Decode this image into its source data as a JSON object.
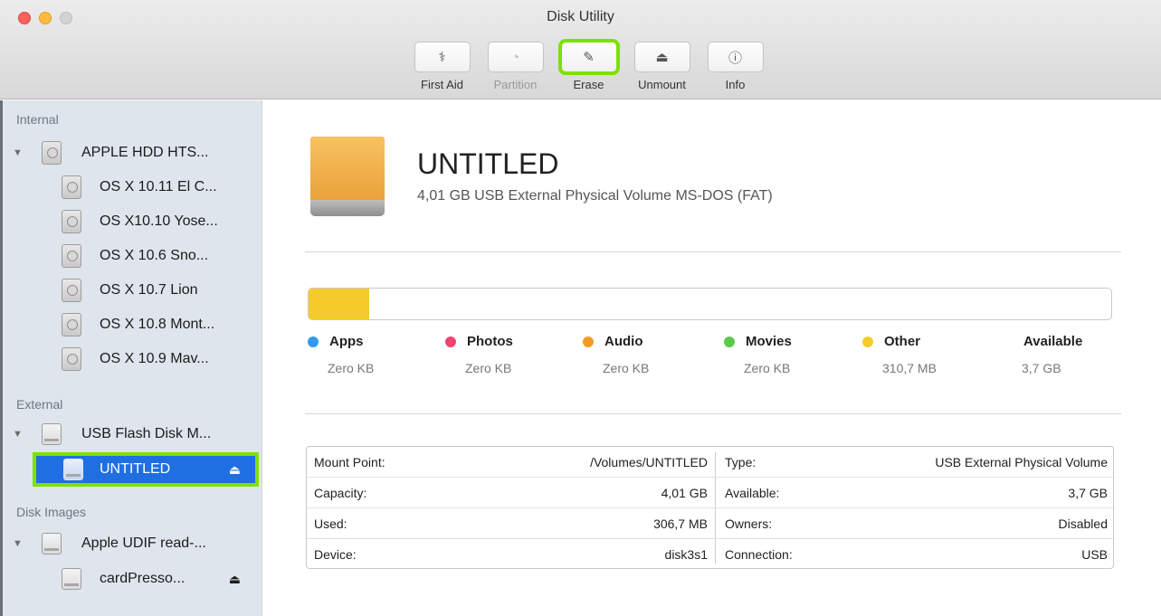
{
  "window": {
    "title": "Disk Utility"
  },
  "toolbar": {
    "buttons": [
      {
        "label": "First Aid",
        "icon": "stethoscope-icon",
        "glyph": "⚕",
        "enabled": true,
        "highlighted": false
      },
      {
        "label": "Partition",
        "icon": "partition-icon",
        "glyph": "◔",
        "enabled": false,
        "highlighted": false
      },
      {
        "label": "Erase",
        "icon": "erase-icon",
        "glyph": "✎",
        "enabled": true,
        "highlighted": true
      },
      {
        "label": "Unmount",
        "icon": "unmount-icon",
        "glyph": "⏏",
        "enabled": true,
        "highlighted": false
      },
      {
        "label": "Info",
        "icon": "info-icon",
        "glyph": "ⓘ",
        "enabled": true,
        "highlighted": false
      }
    ]
  },
  "sidebar": {
    "sections": {
      "internal": "Internal",
      "external": "External",
      "disk_images": "Disk Images"
    },
    "items": [
      {
        "label": "APPLE HDD HTS...",
        "level": 0,
        "kind": "disk"
      },
      {
        "label": "OS X 10.11 El C...",
        "level": 1,
        "kind": "disk"
      },
      {
        "label": "OS X10.10 Yose...",
        "level": 1,
        "kind": "disk"
      },
      {
        "label": "OS X 10.6 Sno...",
        "level": 1,
        "kind": "disk"
      },
      {
        "label": "OS X 10.7 Lion",
        "level": 1,
        "kind": "disk"
      },
      {
        "label": "OS X 10.8 Mont...",
        "level": 1,
        "kind": "disk"
      },
      {
        "label": "OS X 10.9 Mav...",
        "level": 1,
        "kind": "disk"
      },
      {
        "label": "USB Flash Disk M...",
        "level": 0,
        "kind": "usb"
      },
      {
        "label": "UNTITLED",
        "level": 1,
        "kind": "usb",
        "selected": true,
        "eject": "⏏"
      },
      {
        "label": "Apple UDIF read-...",
        "level": 0,
        "kind": "usb"
      },
      {
        "label": "cardPresso...",
        "level": 1,
        "kind": "usb",
        "eject": "⏏"
      }
    ]
  },
  "volume": {
    "name": "UNTITLED",
    "description": "4,01 GB USB External Physical Volume MS-DOS (FAT)",
    "icon": "external-drive-icon"
  },
  "usage": {
    "segments": [
      {
        "name": "Other",
        "fraction": 0.076,
        "color": "#f5cb2c"
      }
    ]
  },
  "legend": [
    {
      "name": "Apps",
      "value": "Zero KB",
      "color": "#2f9bea"
    },
    {
      "name": "Photos",
      "value": "Zero KB",
      "color": "#f0456e"
    },
    {
      "name": "Audio",
      "value": "Zero KB",
      "color": "#f39a26"
    },
    {
      "name": "Movies",
      "value": "Zero KB",
      "color": "#5bc94a"
    },
    {
      "name": "Other",
      "value": "310,7 MB",
      "color": "#f5cb2c"
    },
    {
      "name": "Available",
      "value": "3,7 GB",
      "color": "#ffffff"
    }
  ],
  "info": {
    "rows": [
      {
        "l_key": "Mount Point:",
        "l_val": "/Volumes/UNTITLED",
        "r_key": "Type:",
        "r_val": "USB External Physical Volume"
      },
      {
        "l_key": "Capacity:",
        "l_val": "4,01 GB",
        "r_key": "Available:",
        "r_val": "3,7 GB"
      },
      {
        "l_key": "Used:",
        "l_val": "306,7 MB",
        "r_key": "Owners:",
        "r_val": "Disabled"
      },
      {
        "l_key": "Device:",
        "l_val": "disk3s1",
        "r_key": "Connection:",
        "r_val": "USB"
      }
    ]
  }
}
